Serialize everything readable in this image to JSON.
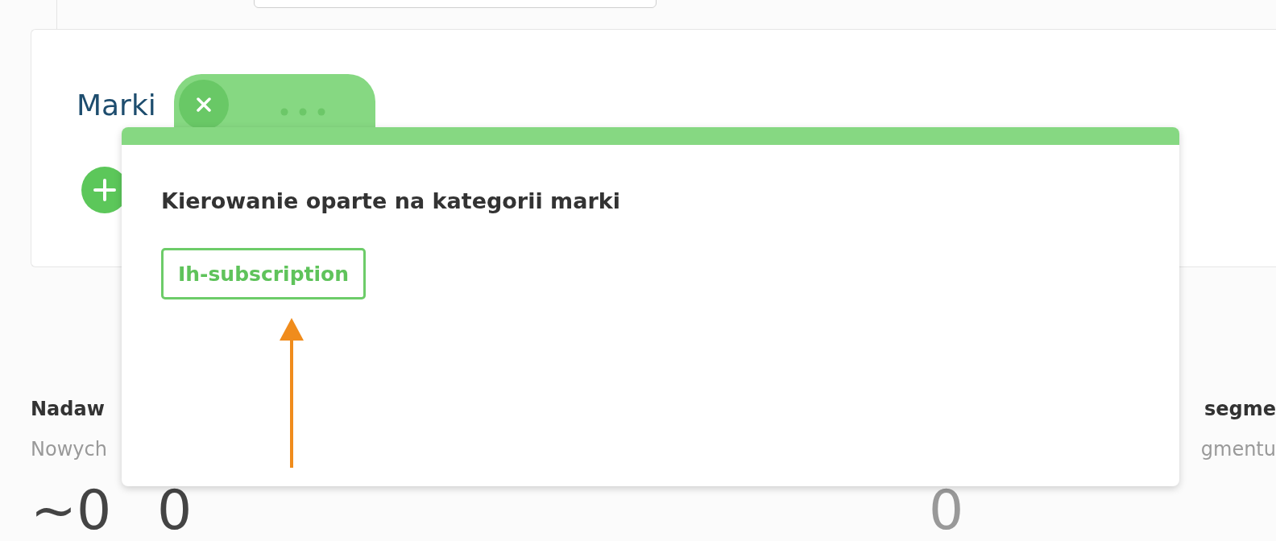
{
  "card": {
    "title": "Marki"
  },
  "popup": {
    "heading": "Kierowanie oparte na kategorii marki",
    "tags": [
      {
        "label": "Ih-subscription"
      }
    ]
  },
  "stats_left": {
    "title": "Nadaw",
    "subtitle": "Nowych"
  },
  "stats_right": {
    "title": "segme",
    "subtitle": "gmentu"
  },
  "values": [
    "~0",
    "0",
    "0"
  ]
}
